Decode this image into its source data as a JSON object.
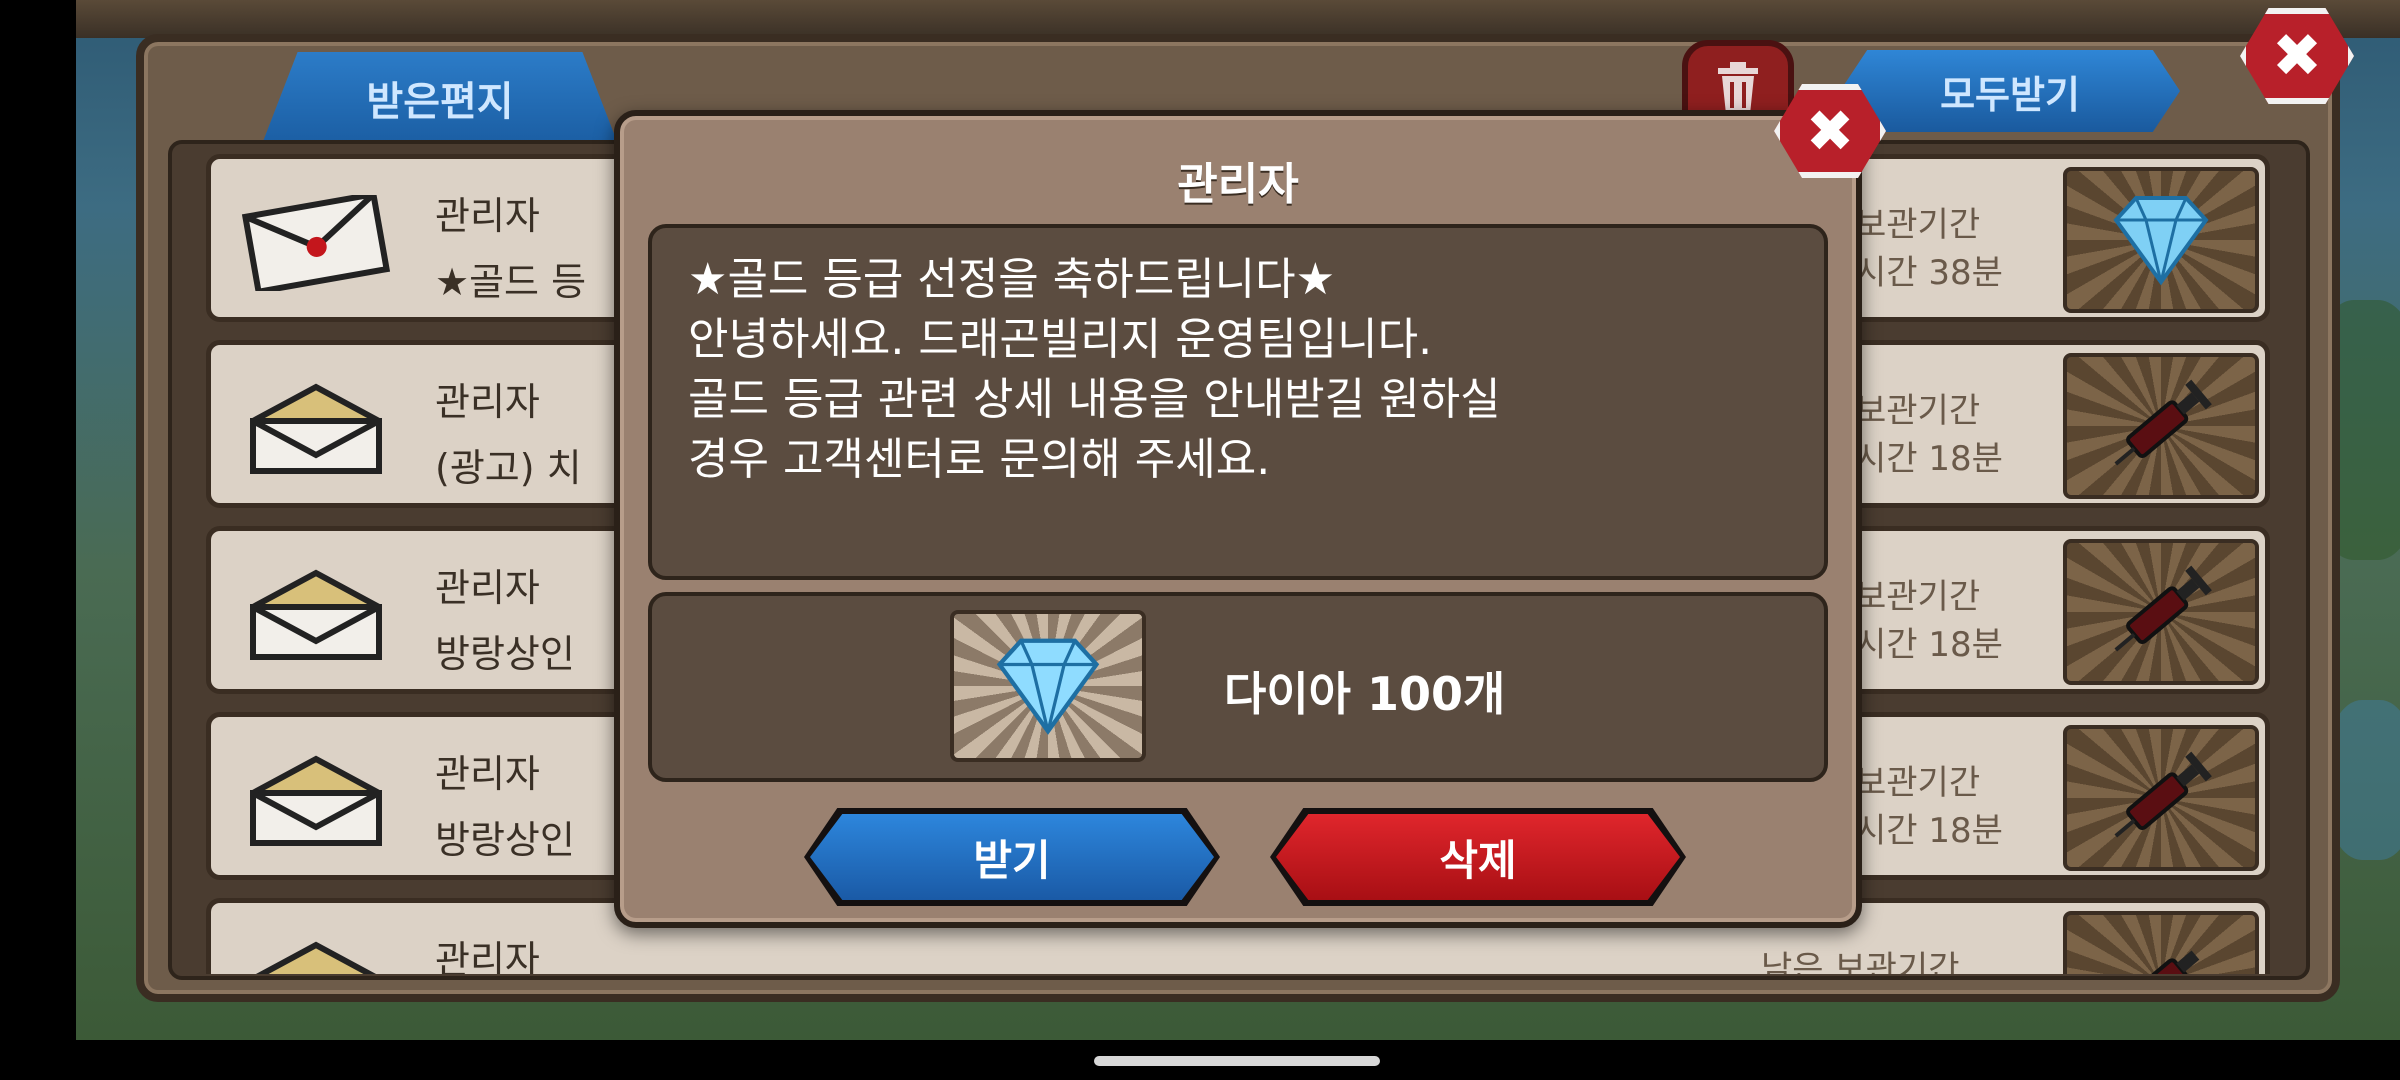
{
  "mailbox": {
    "tab_inbox": "받은편지",
    "take_all_label": "모두받기",
    "rows": [
      {
        "sender": "관리자",
        "subject": "★골드 등",
        "expire_label": "보관기간",
        "expire_time": "시간 38분",
        "item_icon": "diamond-icon"
      },
      {
        "sender": "관리자",
        "subject": "(광고) 치",
        "expire_label": "보관기간",
        "expire_time": "시간 18분",
        "item_icon": "syringe-icon"
      },
      {
        "sender": "관리자",
        "subject": "방랑상인",
        "expire_label": "보관기간",
        "expire_time": "시간 18분",
        "item_icon": "syringe-icon"
      },
      {
        "sender": "관리자",
        "subject": "방랑상인",
        "expire_label": "보관기간",
        "expire_time": "시간 18분",
        "item_icon": "syringe-icon"
      },
      {
        "sender": "관리자",
        "subject": "",
        "expire_label": "남은 보관기간",
        "expire_time": "",
        "item_icon": "syringe-icon"
      }
    ]
  },
  "popup": {
    "title": "관리자",
    "message_lines": [
      "★골드 등급 선정을 축하드립니다★",
      "안녕하세요. 드래곤빌리지 운영팀입니다.",
      "골드 등급 관련 상세 내용을 안내받길 원하실",
      "경우 고객센터로 문의해 주세요."
    ],
    "reward_text": "다이아 100개",
    "receive_button": "받기",
    "delete_button": "삭제"
  },
  "colors": {
    "blue_button": "#1a63b5",
    "red_button": "#c4161c",
    "popup_bg": "#9a8170",
    "panel_bg": "#5b4c40"
  }
}
